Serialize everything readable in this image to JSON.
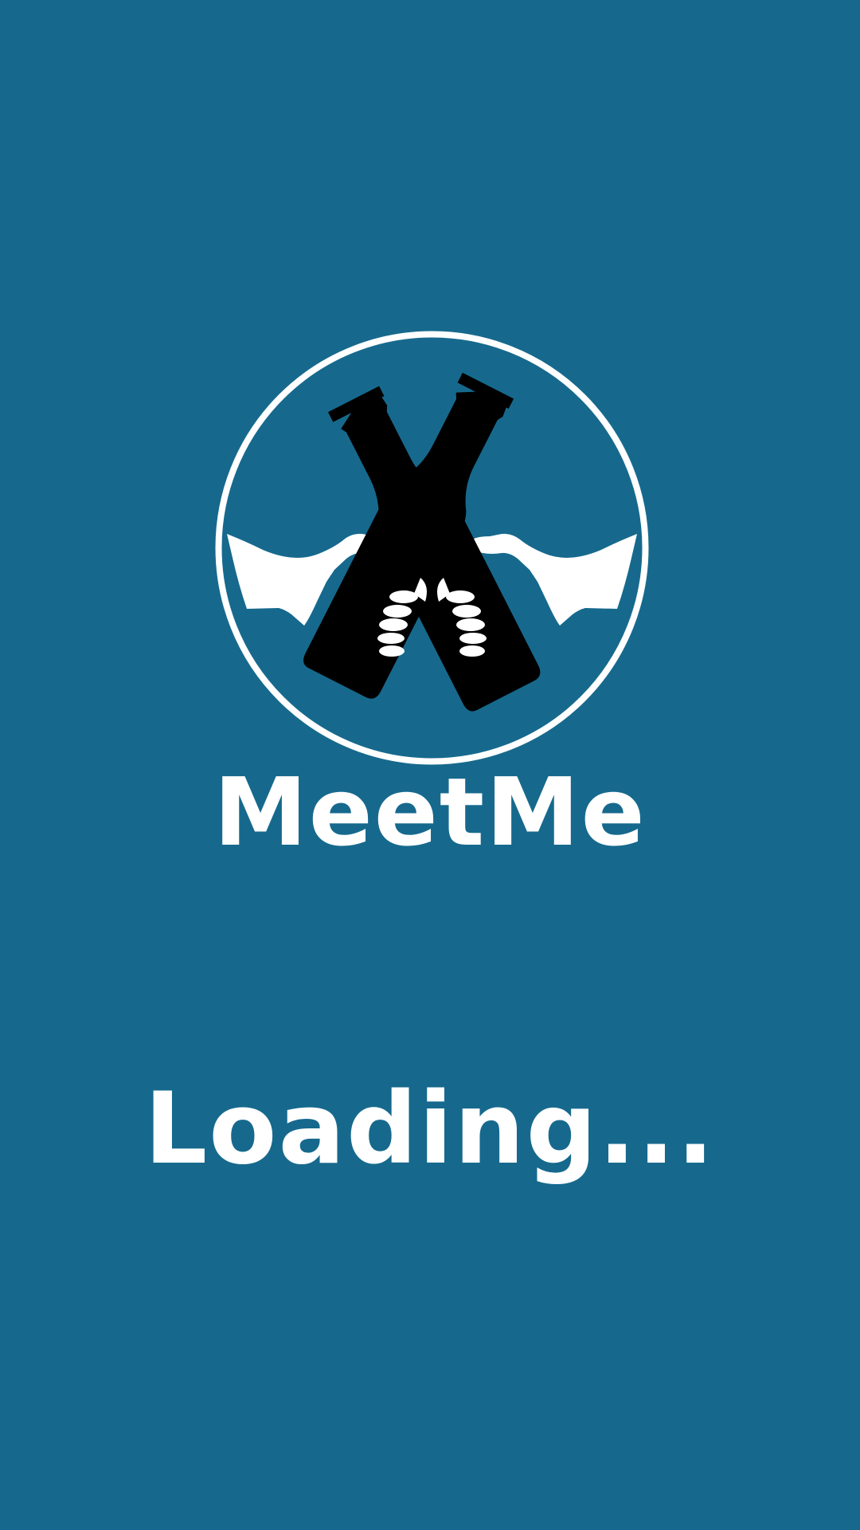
{
  "app": {
    "name": "MeetMe",
    "loading_text": "Loading..."
  },
  "logo": {
    "icon": "beer-bottles-cheers-icon"
  },
  "colors": {
    "background": "#16698d",
    "foreground": "#ffffff",
    "bottle": "#000000"
  }
}
